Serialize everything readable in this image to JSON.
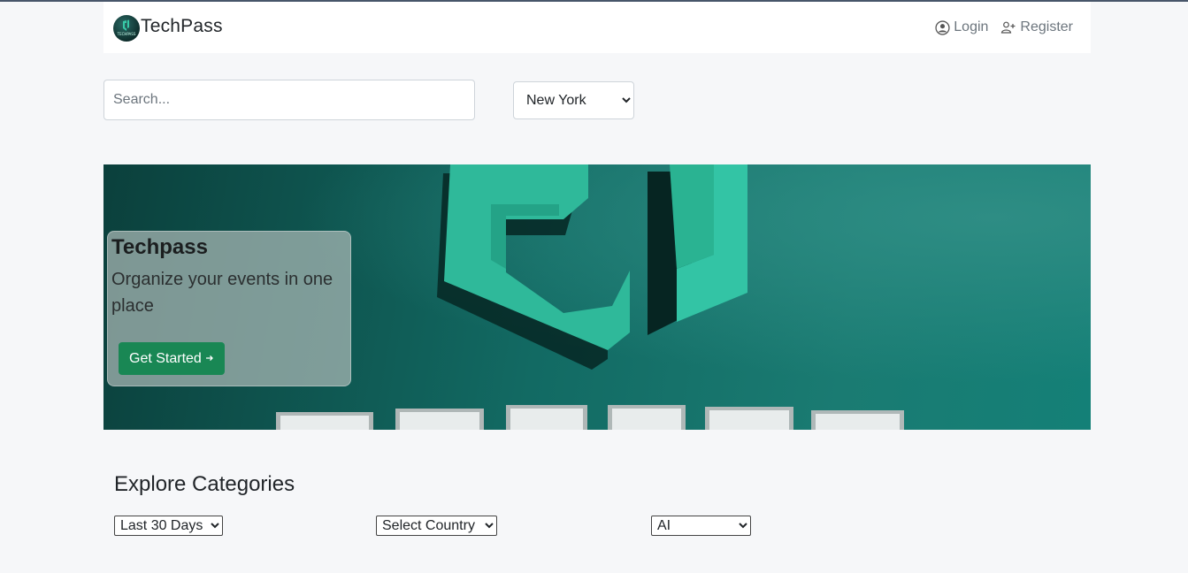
{
  "navbar": {
    "brand_name": "TechPass",
    "logo_icon": "techpass-logo",
    "login_label": "Login",
    "login_icon": "user-circle-icon",
    "register_label": "Register",
    "register_icon": "user-plus-icon"
  },
  "search": {
    "placeholder": "Search...",
    "value": ""
  },
  "city_select": {
    "selected": "New York"
  },
  "hero": {
    "title": "Techpass",
    "subtitle": "Organize your events in one place",
    "cta_label": "Get Started",
    "cta_icon": "arrow-right-icon"
  },
  "categories": {
    "heading": "Explore Categories",
    "date_filter": "Last 30 Days",
    "country_filter": "Select Country",
    "category_filter": "AI"
  },
  "colors": {
    "accent_green": "#198754",
    "hero_teal": "#126a63",
    "logo_mint": "#33c4a5"
  }
}
